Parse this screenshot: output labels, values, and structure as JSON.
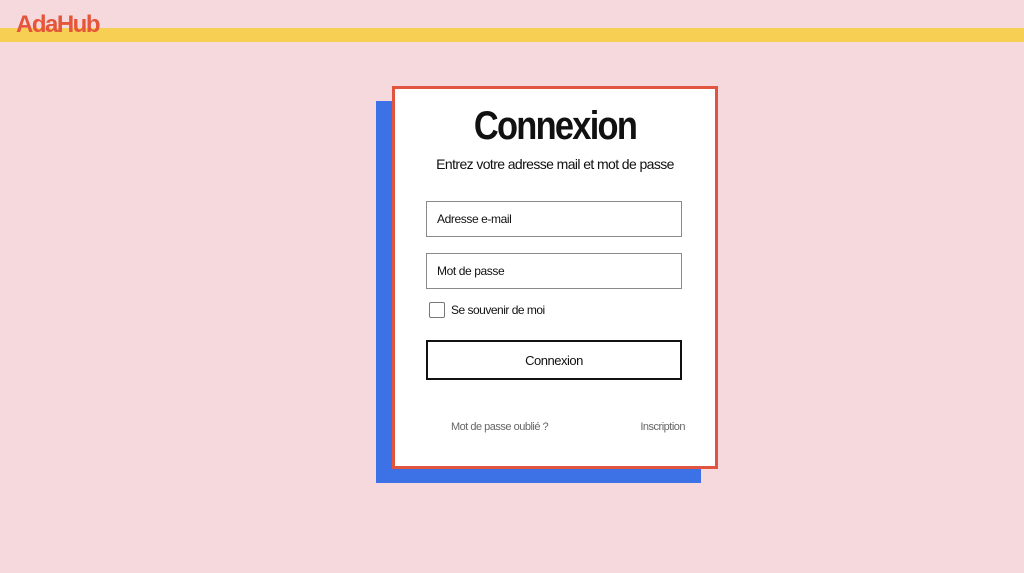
{
  "header": {
    "brand": "AdaHub"
  },
  "login": {
    "title": "Connexion",
    "subtitle": "Entrez votre adresse mail et mot de passe",
    "email_placeholder": "Adresse e-mail",
    "password_placeholder": "Mot de passe",
    "remember_label": "Se souvenir de moi",
    "remember_checked": false,
    "submit_label": "Connexion",
    "forgot_link": "Mot de passe oublié ?",
    "signup_link": "Inscription"
  },
  "colors": {
    "background": "#f5d9dc",
    "topbar": "#f7cf52",
    "brand": "#e4553a",
    "card_border": "#e1543f",
    "card_shadow": "#3d72e6"
  }
}
